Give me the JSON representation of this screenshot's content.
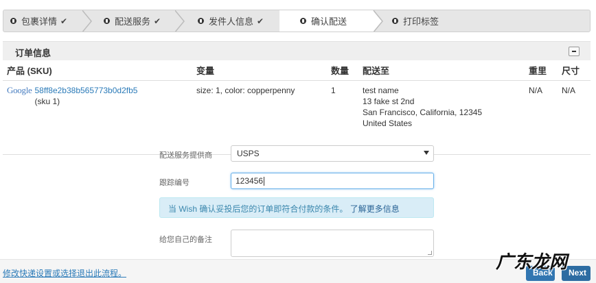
{
  "steps": [
    {
      "label": "包裹详情",
      "check": "✔"
    },
    {
      "label": "配送服务",
      "check": "✔"
    },
    {
      "label": "发件人信息",
      "check": "✔"
    },
    {
      "label": "确认配送",
      "check": ""
    },
    {
      "label": "打印标签",
      "check": ""
    }
  ],
  "panel": {
    "title": "订单信息"
  },
  "table": {
    "headers": [
      "产品 (SKU)",
      "变量",
      "数量",
      "配送至",
      "重里",
      "尺寸"
    ],
    "row": {
      "logo": "Google",
      "sku_link": "58ff8e2b38b565773b0d2fb5",
      "sku_sub": "(sku 1)",
      "variant": "size: 1, color: copperpenny",
      "qty": "1",
      "ship_to": [
        "test name",
        "13 fake st 2nd",
        "San Francisco, California, 12345",
        "United States"
      ],
      "weight": "N/A",
      "size": "N/A"
    }
  },
  "form": {
    "carrier_label": "配送服务提供商",
    "carrier_value": "USPS",
    "tracking_label": "跟踪编号",
    "tracking_value": "123456",
    "notice_text": "当 Wish 确认妥投后您的订单即符合付款的条件。",
    "notice_link": "了解更多信息",
    "note_label": "给您自己的备注"
  },
  "footer": {
    "link": "修改快递设置或选择退出此流程。",
    "back": "Back",
    "next": "Next"
  },
  "watermark": "广东龙网",
  "colors": {
    "link": "#2a7ab8",
    "alert_bg": "#d9edf7",
    "button": "#3276b1"
  }
}
